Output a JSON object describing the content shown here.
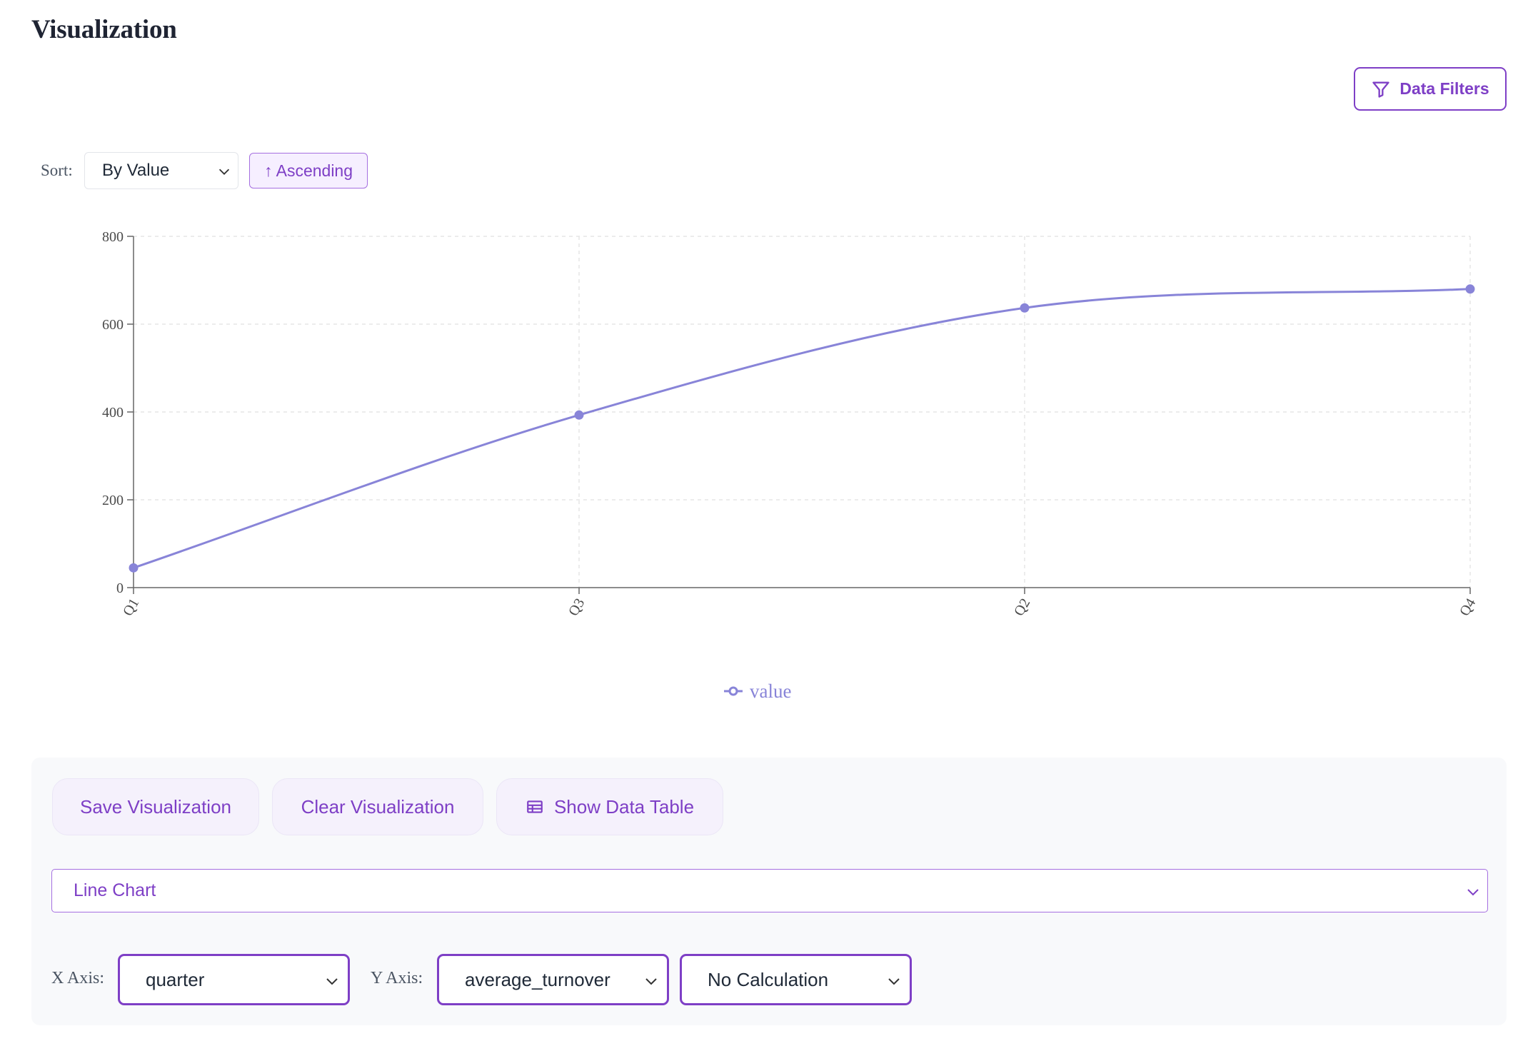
{
  "page": {
    "title": "Visualization"
  },
  "toolbar": {
    "filters_label": "Data Filters"
  },
  "sort": {
    "label": "Sort:",
    "selected": "By Value",
    "direction_label": "↑ Ascending"
  },
  "chart_data": {
    "type": "line",
    "categories": [
      "Q1",
      "Q3",
      "Q2",
      "Q4"
    ],
    "series": [
      {
        "name": "value",
        "values": [
          45,
          393,
          637,
          680
        ],
        "color": "#8884d8"
      }
    ],
    "ylim": [
      0,
      800
    ],
    "yticks": [
      0,
      200,
      400,
      600,
      800
    ],
    "grid": true,
    "legend": "bottom-center"
  },
  "actions": {
    "save_label": "Save Visualization",
    "clear_label": "Clear Visualization",
    "table_label": "Show Data Table"
  },
  "chart_type": {
    "selected": "Line Chart"
  },
  "axes": {
    "x_label": "X Axis:",
    "x_value": "quarter",
    "y_label": "Y Axis:",
    "y_value": "average_turnover",
    "calc_value": "No Calculation"
  },
  "colors": {
    "accent": "#7e3fc6",
    "series": "#8884d8"
  }
}
